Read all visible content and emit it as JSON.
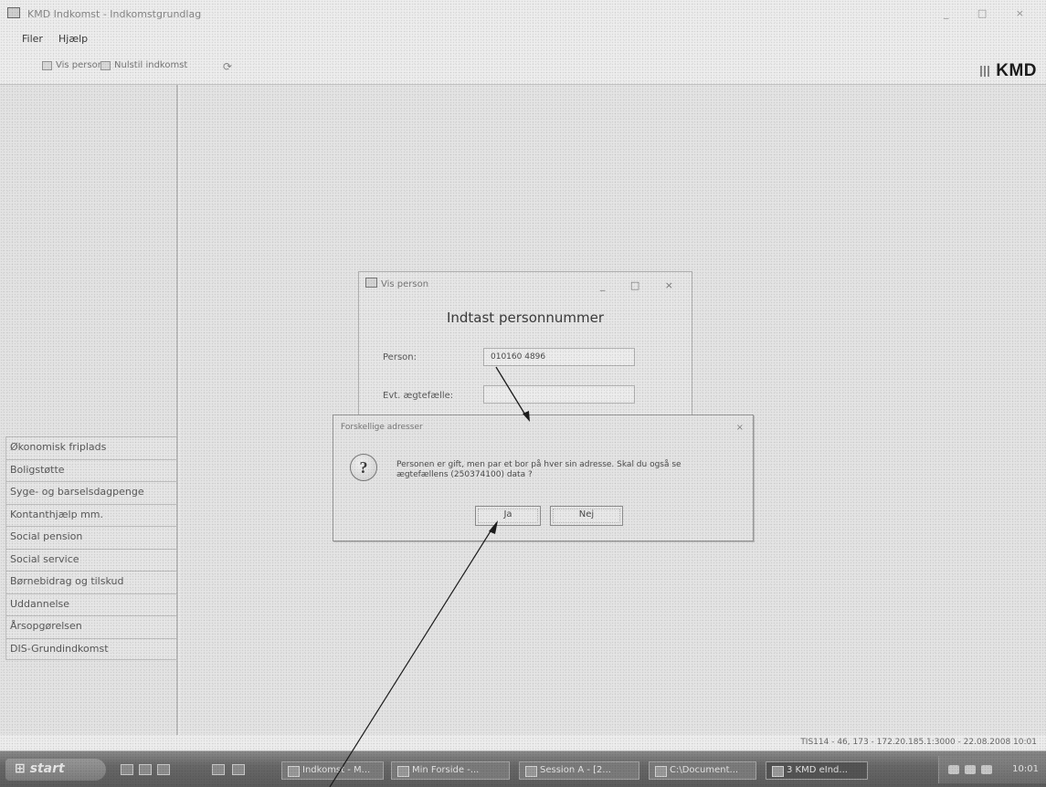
{
  "window": {
    "title": "KMD Indkomst - Indkomstgrundlag",
    "controls": "_ □ ×"
  },
  "menu": [
    "Filer",
    "Hjælp"
  ],
  "toolbar": {
    "vis_person": "Vis person",
    "second": "Nulstil indkomst"
  },
  "brand": "KMD",
  "nav": {
    "items": [
      "Økonomisk friplads",
      "Boligstøtte",
      "Syge- og barselsdagpenge",
      "Kontanthjælp mm.",
      "Social pension",
      "Social service",
      "Børnebidrag og tilskud",
      "Uddannelse",
      "Årsopgørelsen",
      "DIS-Grundindkomst"
    ]
  },
  "vis_person": {
    "title": "Vis person",
    "controls": "_ □ ×",
    "heading": "Indtast personnummer",
    "person_label": "Person:",
    "person_value": "010160 4896",
    "spouse_label": "Evt. ægtefælle:",
    "spouse_value": ""
  },
  "dialog": {
    "title": "Forskellige adresser",
    "close": "×",
    "icon": "question-icon",
    "message": "Personen er gift, men par et bor på hver sin adresse. Skal du også se ægtefællens (250374100) data ?",
    "yes": "Ja",
    "no": "Nej"
  },
  "status": {
    "text": "TIS114 - 46, 173 - 172.20.185.1:3000 - 22.08.2008 10:01"
  },
  "taskbar": {
    "start": "start",
    "items": [
      "Indkomst - M...",
      "Min Forside -...",
      "Session A - [2...",
      "C:\\Document...",
      "3 KMD eInd..."
    ],
    "clock": "10:01"
  }
}
